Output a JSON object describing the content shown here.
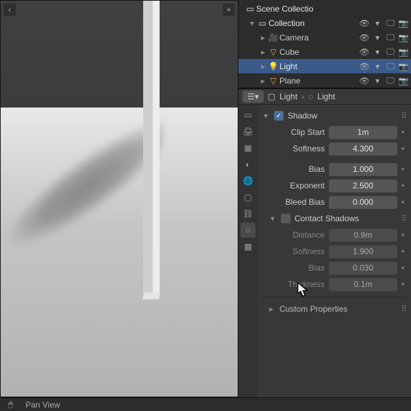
{
  "outliner": {
    "root": "Scene Collectio",
    "collection": "Collection",
    "items": [
      {
        "name": "Camera"
      },
      {
        "name": "Cube"
      },
      {
        "name": "Light",
        "selected": true
      },
      {
        "name": "Plane"
      }
    ]
  },
  "breadcrumb": {
    "pill": "",
    "light1": "Light",
    "light2": "Light"
  },
  "panels": {
    "shadow": {
      "title": "Shadow",
      "clip_start_label": "Clip Start",
      "clip_start": "1m",
      "softness_label": "Softness",
      "softness": "4.300",
      "bias_label": "Bias",
      "bias": "1.000",
      "exponent_label": "Exponent",
      "exponent": "2.500",
      "bleed_label": "Bleed Bias",
      "bleed": "0.000"
    },
    "contact": {
      "title": "Contact Shadows",
      "distance_label": "Distance",
      "distance": "0.9m",
      "softness_label": "Softness",
      "softness": "1.900",
      "bias_label": "Bias",
      "bias": "0.030",
      "thickness_label": "Thickness",
      "thickness": "0.1m"
    },
    "custom": "Custom Properties"
  },
  "statusbar": {
    "mouse": "",
    "label": "Pan View"
  }
}
